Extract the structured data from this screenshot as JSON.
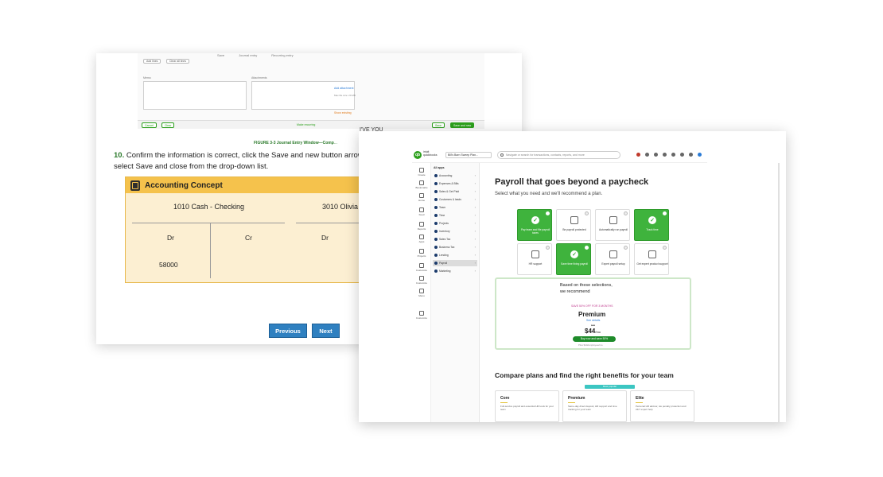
{
  "left_doc": {
    "screenshot": {
      "top_nav": [
        "Save",
        "Journal entry",
        "Recurring entry"
      ],
      "buttons": [
        "Add lines",
        "Clear all lines"
      ],
      "memo_label": "Memo",
      "attachments_label": "Attachments",
      "add_attachment_link": "Add attachment",
      "attachment_sub": "Max file size: 20 MB",
      "show_existing": "Show existing",
      "footer_cancel": "Cancel",
      "footer_clear": "Clear",
      "footer_mid": "Make recurring",
      "footer_save": "Save",
      "footer_save_new": "Save and new"
    },
    "figure_caption": "FIGURE 3-3 Journal Entry Window—Comp",
    "figure_caption_more": "...",
    "step_number": "10.",
    "step_text": "Confirm the information is correct, click the Save and new button arrow, select Save and close from the drop-down list.",
    "overlay_label": "I'VE YOU",
    "concept": {
      "title": "Accounting Concept",
      "account_left": "1010 Cash - Checking",
      "account_right": "3010 Olivia",
      "dr1": "Dr",
      "cr1": "Cr",
      "dr2": "Dr",
      "amount": "58000"
    },
    "nav": {
      "previous": "Previous",
      "next": "Next"
    }
  },
  "app": {
    "logo_text": "intuit quickbooks",
    "company": "Bill's Barn Sweep Plan...",
    "search_placeholder": "Navigate or search for transactions, contacts, reports, and more",
    "rail": [
      "Create",
      "Bookmarks",
      "Home",
      "Feed",
      "Reports",
      "Apps",
      "Projects",
      "Customize",
      "Customize",
      "Menu"
    ],
    "rail_bottom": "Customize",
    "pane_title": "All apps",
    "pane_items": [
      {
        "label": "Accounting",
        "active": false
      },
      {
        "label": "Expenses & Bills",
        "active": false
      },
      {
        "label": "Sales & Get Paid",
        "active": false
      },
      {
        "label": "Customers & leads",
        "active": false
      },
      {
        "label": "Team",
        "active": false
      },
      {
        "label": "Time",
        "active": false
      },
      {
        "label": "Projects",
        "active": false
      },
      {
        "label": "Inventory",
        "active": false
      },
      {
        "label": "Sales Tax",
        "active": false
      },
      {
        "label": "Business Tax",
        "active": false
      },
      {
        "label": "Lending",
        "active": false
      },
      {
        "label": "Payroll",
        "active": true
      },
      {
        "label": "Marketing",
        "active": false
      }
    ],
    "title": "Payroll that goes beyond a paycheck",
    "subtitle": "Select what you need and we'll recommend a plan.",
    "tiles": [
      {
        "label": "Pay team and file payroll taxes",
        "on": true
      },
      {
        "label": "Be payroll protected",
        "on": false
      },
      {
        "label": "Automatically run payroll",
        "on": false
      },
      {
        "label": "Track time",
        "on": true
      },
      {
        "label": "HR support",
        "on": false
      },
      {
        "label": "Save time fixing payroll",
        "on": true
      },
      {
        "label": "Expert payroll setup",
        "on": false
      },
      {
        "label": "Get expert product support",
        "on": false
      }
    ],
    "rec": {
      "text": "Based on these selections, we recommend",
      "save_badge": "SAVE 50% OFF FOR 3 MONTHS",
      "plan": "Premium",
      "link": "See details",
      "was": "$88",
      "price": "$44",
      "price_unit": "/mo",
      "cta": "Buy now and save 50%",
      "fine": "Plus $10/employee/mo"
    },
    "compare_title": "Compare plans and find the right benefits for your team",
    "teal_bar": "Most popular",
    "plans": [
      {
        "name": "Core",
        "desc": "Full-service payroll and essential HR tools for your team"
      },
      {
        "name": "Premium",
        "desc": "Same-day direct deposit, HR support and time tracking for your team"
      },
      {
        "name": "Elite",
        "desc": "Personal HR advisor, tax penalty protection and 24/7 expert help"
      }
    ]
  }
}
